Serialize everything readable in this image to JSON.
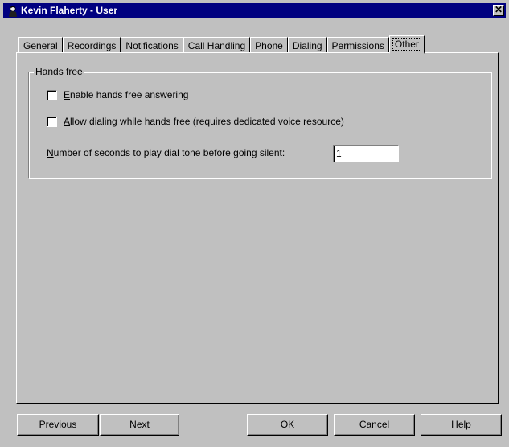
{
  "window": {
    "title": "Kevin Flaherty - User",
    "close_label": "✕"
  },
  "tabs": [
    {
      "label": "General",
      "active": false
    },
    {
      "label": "Recordings",
      "active": false
    },
    {
      "label": "Notifications",
      "active": false
    },
    {
      "label": "Call Handling",
      "active": false
    },
    {
      "label": "Phone",
      "active": false
    },
    {
      "label": "Dialing",
      "active": false
    },
    {
      "label": "Permissions",
      "active": false
    },
    {
      "label": "Other",
      "active": true
    }
  ],
  "hands_free": {
    "group_title": "Hands free",
    "enable_answering": {
      "accel": "E",
      "label_rest": "nable hands free answering",
      "checked": false
    },
    "allow_dialing": {
      "accel": "A",
      "label_rest": "llow dialing while hands free (requires dedicated voice resource)",
      "checked": false
    },
    "dial_tone_seconds": {
      "accel": "N",
      "label_rest": "umber of seconds to play dial tone before going silent:",
      "value": "1"
    }
  },
  "buttons": {
    "previous": {
      "pre": "Pre",
      "accel": "v",
      "post": "ious"
    },
    "next": {
      "pre": "Ne",
      "accel": "x",
      "post": "t"
    },
    "ok": {
      "label": "OK"
    },
    "cancel": {
      "label": "Cancel"
    },
    "help": {
      "pre": "",
      "accel": "H",
      "post": "elp"
    }
  }
}
